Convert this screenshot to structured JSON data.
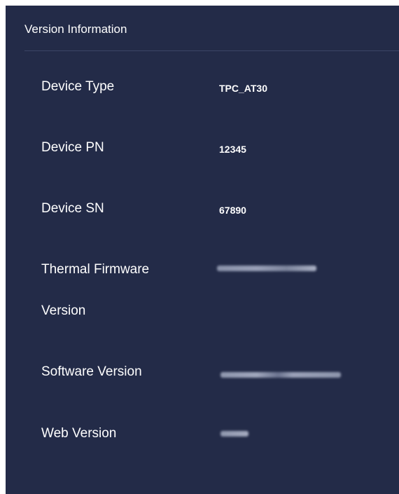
{
  "panel": {
    "title": "Version Information"
  },
  "rows": [
    {
      "label": "Device Type",
      "value": "TPC_AT30"
    },
    {
      "label": "Device PN",
      "value": "12345"
    },
    {
      "label": "Device SN",
      "value": "67890"
    },
    {
      "label_line1": "Thermal Firmware",
      "label_line2": "Version",
      "value_redacted": true
    },
    {
      "label": "Software Version",
      "value_redacted": true
    },
    {
      "label": "Web Version",
      "value_redacted": true
    }
  ],
  "colors": {
    "panel_background": "#232b48",
    "divider": "#3c4566",
    "text": "#ffffff"
  }
}
